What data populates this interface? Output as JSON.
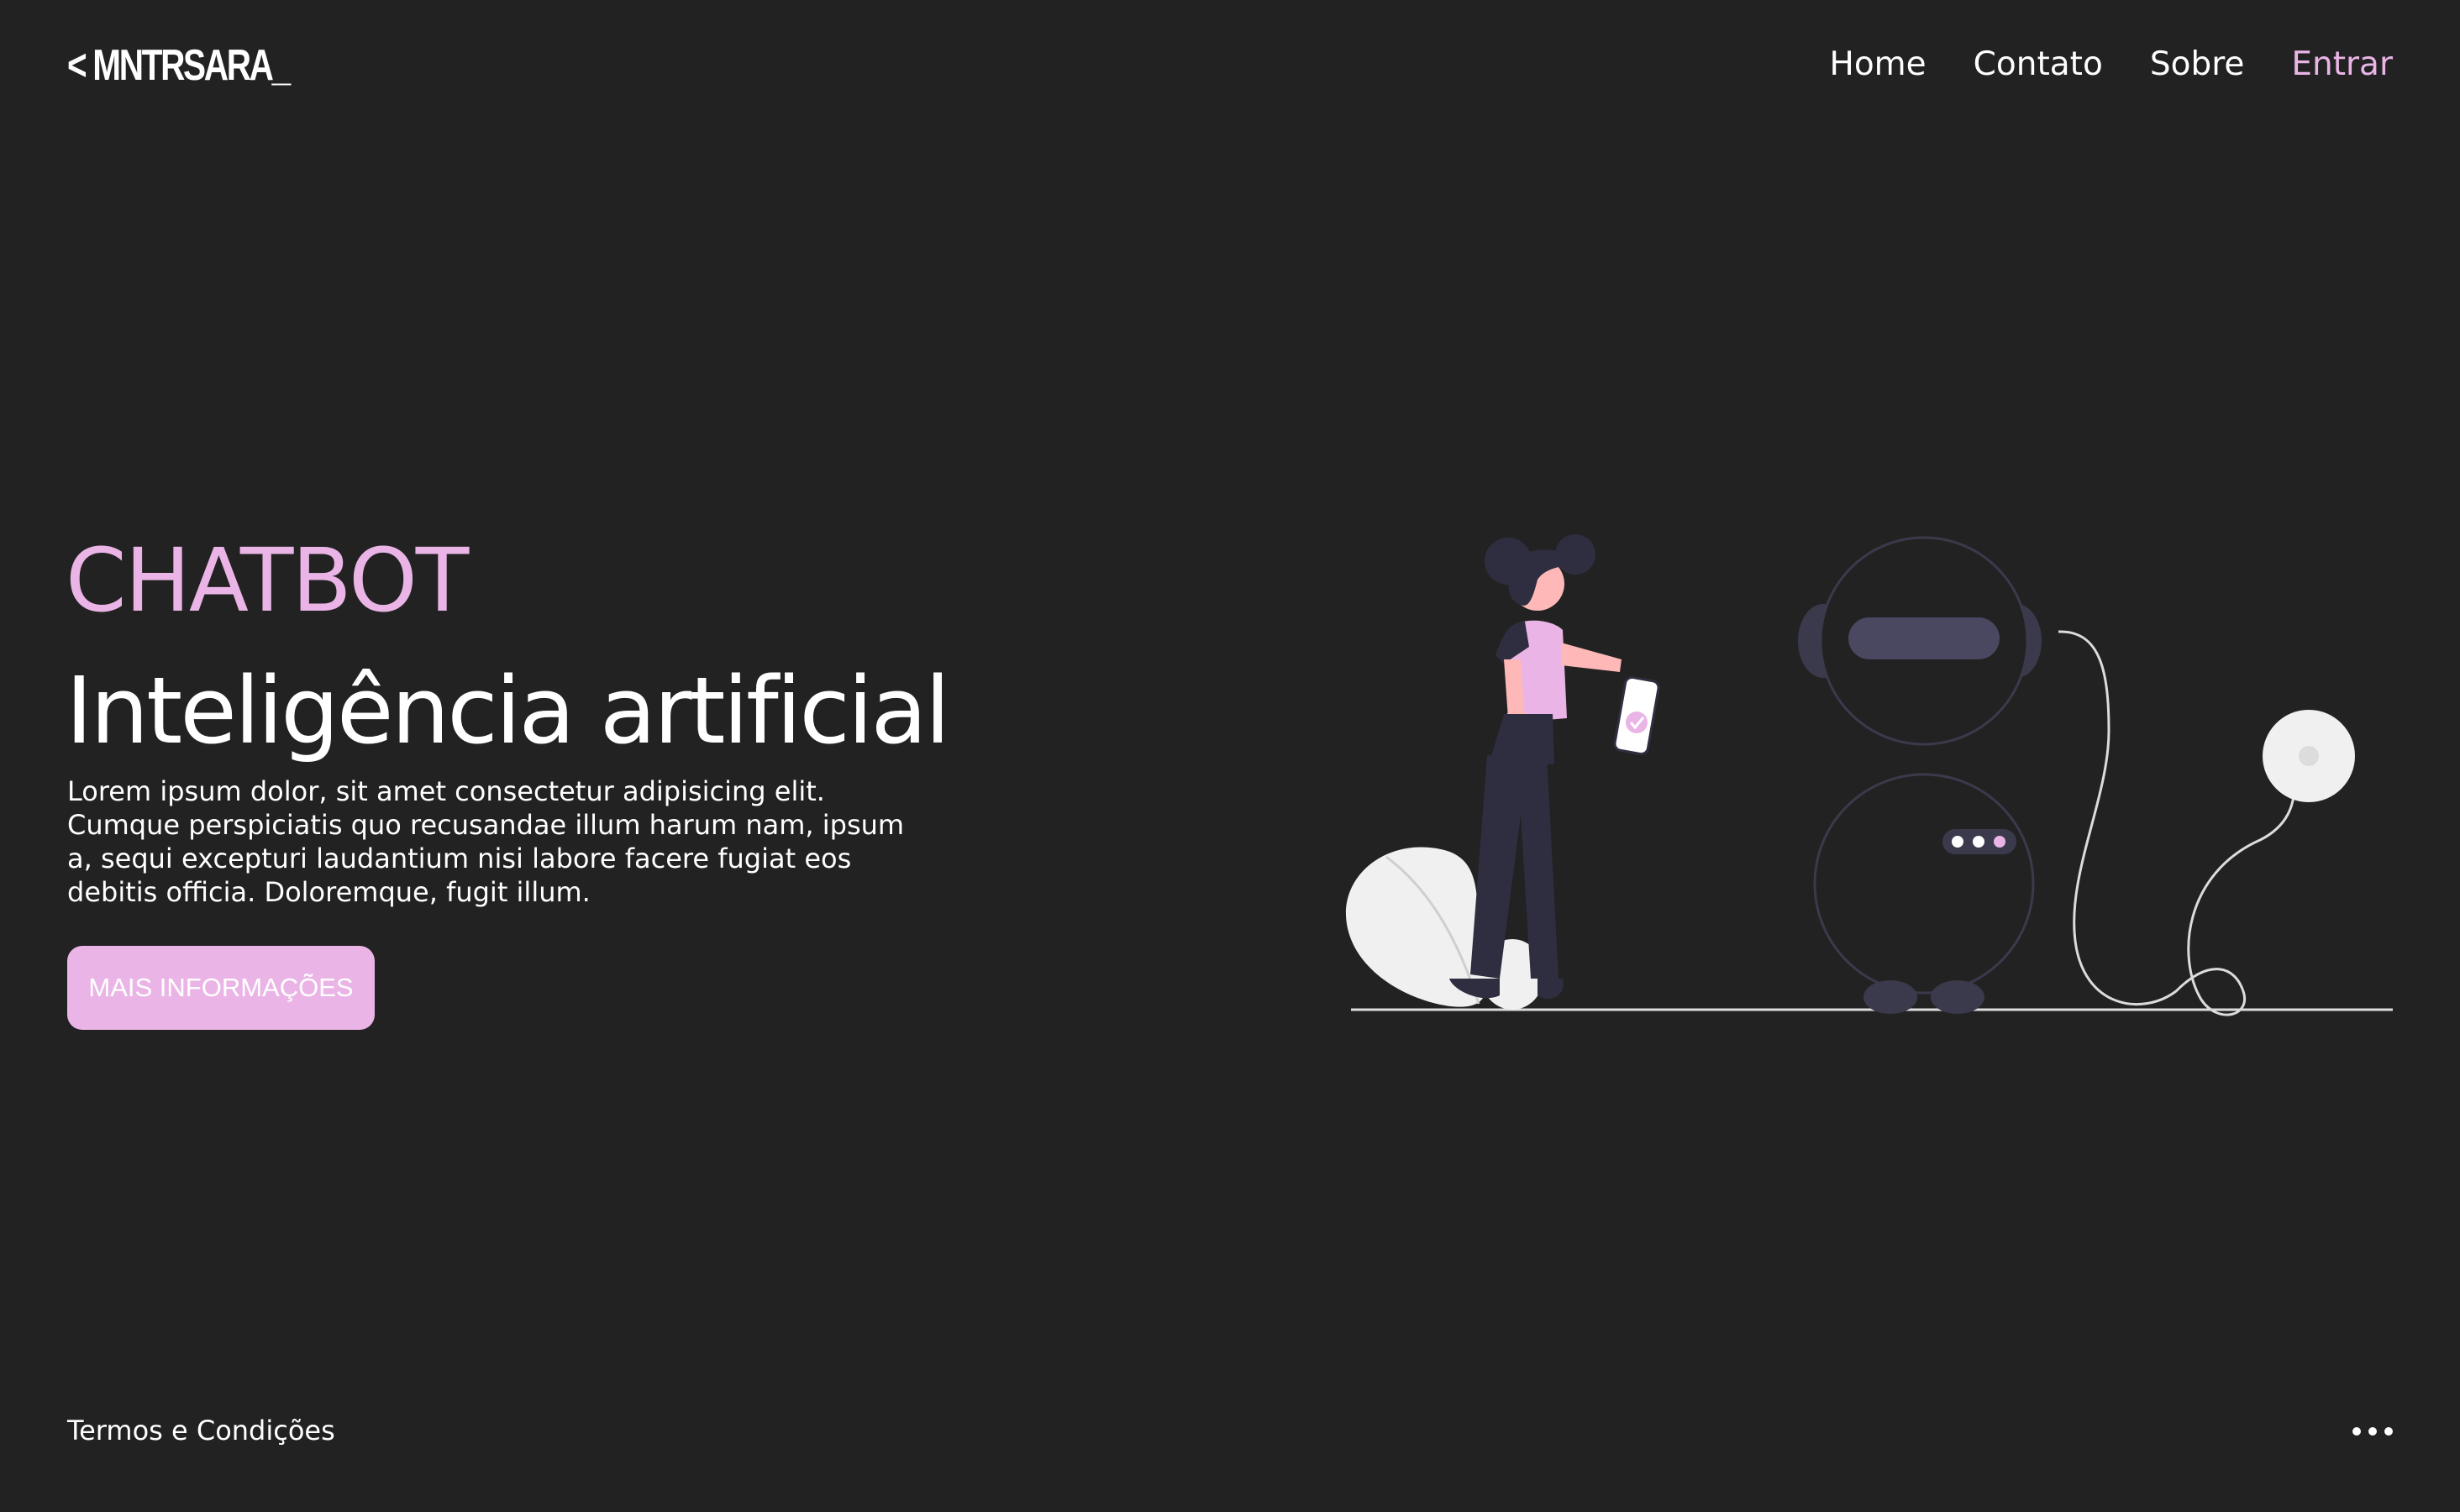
{
  "header": {
    "logo": "< MNTRSARA_",
    "nav": {
      "home": "Home",
      "contact": "Contato",
      "about": "Sobre",
      "login": "Entrar"
    }
  },
  "hero": {
    "subtitle": "CHATBOT",
    "title": "Inteligência artificial",
    "description": "Lorem ipsum dolor, sit amet consectetur adipisicing elit. Cumque perspiciatis quo recusandae illum harum nam, ipsum a, sequi excepturi laudantium nisi labore facere fugiat eos debitis officia. Doloremque, fugit illum.",
    "button": "MAIS INFORMAÇÕES"
  },
  "footer": {
    "terms": "Termos e Condições",
    "more_icon": "more-horizontal-icon"
  },
  "illustration": {
    "name": "chatbot-illustration",
    "colors": {
      "accent": "#eab5e6",
      "dark": "#2f2e41",
      "robot_visor": "#4a4761",
      "skin": "#ffb8b8",
      "light": "#f0f0f0"
    }
  },
  "colors": {
    "background": "#222222",
    "accent": "#eab5e6",
    "text": "#ffffff"
  }
}
